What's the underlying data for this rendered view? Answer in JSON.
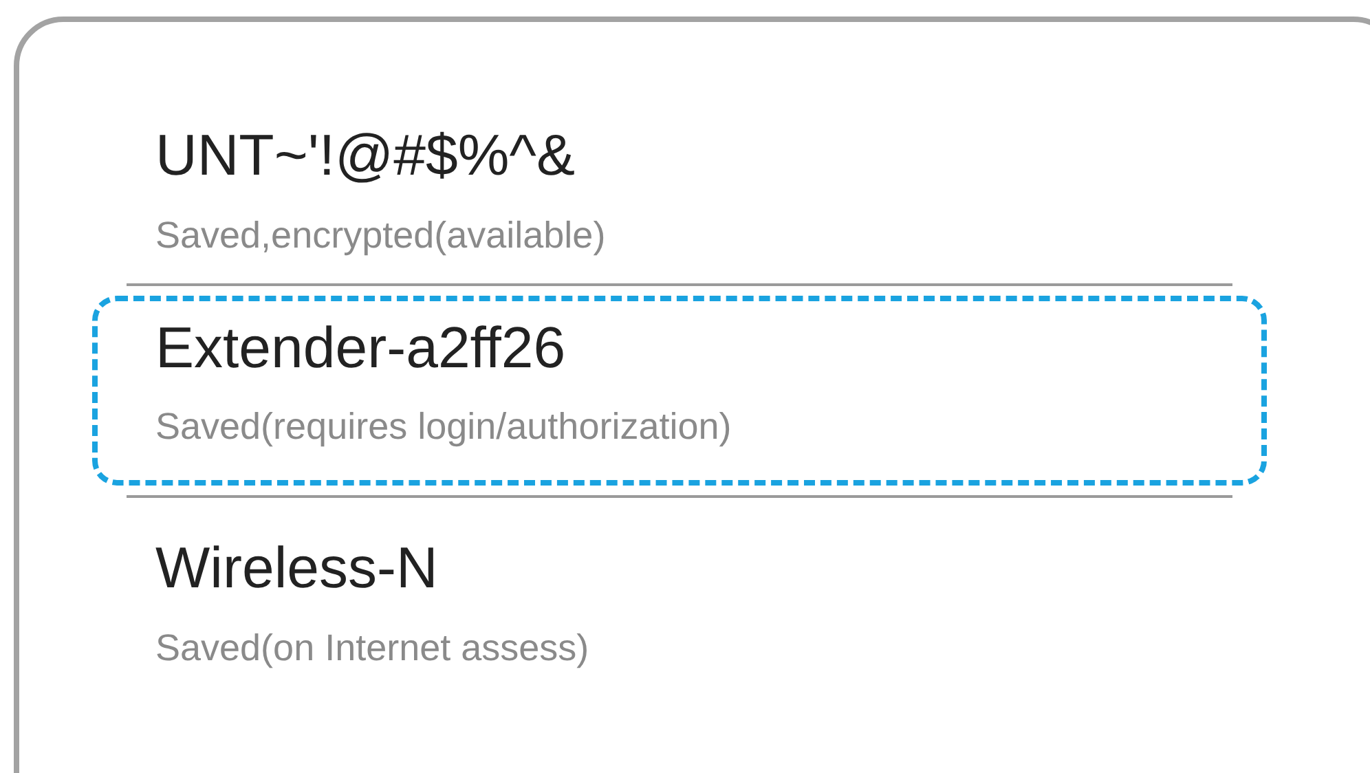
{
  "networks": [
    {
      "name": "UNT~'!@#$%^&",
      "status": "Saved,encrypted(available)",
      "selected": false
    },
    {
      "name": "Extender-a2ff26",
      "status": "Saved(requires login/authorization)",
      "selected": true
    },
    {
      "name": "Wireless-N",
      "status": "Saved(on Internet assess)",
      "selected": false
    }
  ]
}
